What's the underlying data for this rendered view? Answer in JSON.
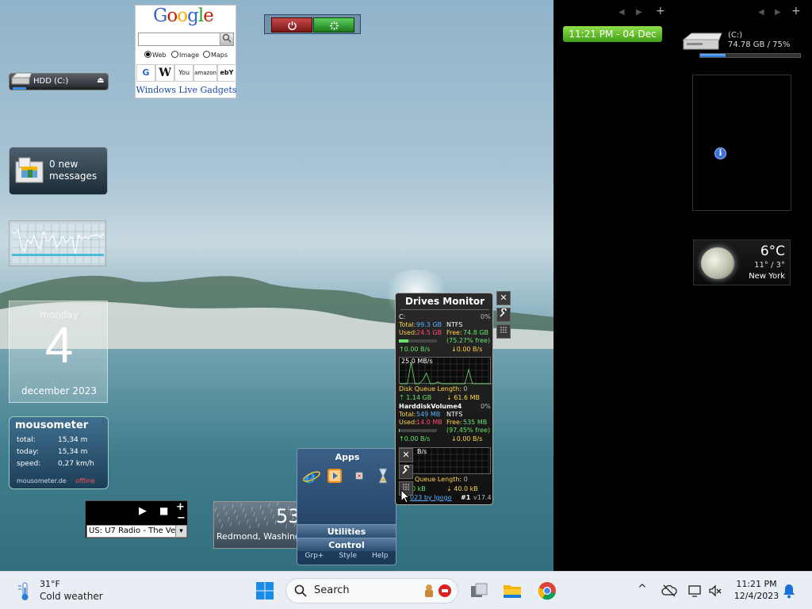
{
  "sidebar": {
    "nav_prev": "◀",
    "nav_next": "▶",
    "nav_add": "+",
    "clock": "11:21 PM - 04 Dec",
    "drive_name": "(C:)",
    "drive_usage": "74.78 GB / 75%",
    "drive_fill_percent": 25,
    "info_glyph": "i",
    "weather_temp": "6°C",
    "weather_range": "11° / 3°",
    "weather_city": "New York"
  },
  "google": {
    "logo_letters": [
      {
        "ch": "G",
        "color": "#3366cc"
      },
      {
        "ch": "o",
        "color": "#cc2200"
      },
      {
        "ch": "o",
        "color": "#ffaa00"
      },
      {
        "ch": "g",
        "color": "#3366cc"
      },
      {
        "ch": "l",
        "color": "#22aa22"
      },
      {
        "ch": "e",
        "color": "#cc2200"
      }
    ],
    "go_icon": "search-icon",
    "radio_web": "Web",
    "radio_image": "Image",
    "radio_maps": "Maps",
    "sites": [
      "G",
      "W",
      "You",
      "amazon",
      "ebY"
    ],
    "footer": "Windows Live Gadgets"
  },
  "shutdown": {
    "power_icon": "power-icon",
    "restart_icon": "restart-icon"
  },
  "hdd": {
    "label": "HDD (C:)",
    "eject": "⏏",
    "fill_percent": 15
  },
  "mail": {
    "line1": "0 new",
    "line2": "messages"
  },
  "cpu": {
    "values": [
      40,
      38,
      42,
      20,
      15,
      30,
      25,
      35,
      22,
      18,
      40,
      28,
      30,
      36,
      20,
      25,
      34,
      26,
      30,
      33,
      12,
      36,
      30,
      34,
      31,
      35,
      35,
      36,
      33,
      38
    ]
  },
  "calendar": {
    "day_name": "monday",
    "date": "4",
    "month_year": "december 2023"
  },
  "mousometer": {
    "title": "mousometer",
    "rows": [
      {
        "label": "total:",
        "value": "15,34 m"
      },
      {
        "label": "today:",
        "value": "15,34 m"
      },
      {
        "label": "speed:",
        "value": "0,27 km/h"
      }
    ],
    "site": "mousometer.de",
    "status": "offline"
  },
  "radio": {
    "play": "▶",
    "stop": "■",
    "plus": "+",
    "minus": "−",
    "station": "US: U7 Radio - The Ve",
    "arrow": "▾"
  },
  "weather_left": {
    "temp": "53",
    "city": "Redmond, Washing"
  },
  "apps": {
    "title": "Apps",
    "categories": [
      "Utilities",
      "Control"
    ],
    "footer": [
      "Grp+",
      "Style",
      "Help"
    ]
  },
  "drives_monitor": {
    "title": "Drives Monitor",
    "drive1": {
      "name": "C:",
      "percent": "0%",
      "total_label": "Total:",
      "total": "99.3 GB",
      "fs": "NTFS",
      "used_label": "Used:",
      "used": "24.5 GB",
      "free_label": "Free:",
      "free": "74.8 GB",
      "free_pct": "(75.27% free)",
      "read": "0.00 B/s",
      "write": "0.00 B/s",
      "graph_label": "25.0 MB/s",
      "queue_label": "Disk Queue Length:",
      "queue": "0",
      "bytes_read": "1.14 GB",
      "bytes_written": "61.6 MB",
      "graph": [
        0,
        0,
        0,
        60,
        0,
        0,
        10,
        30,
        0,
        0,
        5,
        0,
        0,
        0,
        0,
        0,
        0,
        0,
        40,
        0,
        0,
        0,
        0,
        0,
        0
      ]
    },
    "drive2": {
      "name": "HarddiskVolume4",
      "percent": "0%",
      "total_label": "Total:",
      "total": "549 MB",
      "fs": "NTFS",
      "used_label": "Used:",
      "used": "14.0 MB",
      "free_label": "Free:",
      "free": "535 MB",
      "free_pct": "(97.45% free)",
      "read": "0.00 B/s",
      "write": "0.00 B/s",
      "graph_label": "B/s",
      "queue_label": "Queue Length:",
      "queue": "0",
      "bytes_read": "0 kB",
      "bytes_written": "40.0 kB"
    },
    "footer_link": "023 by Igogo",
    "footer_num": "#1",
    "footer_ver": "v17.4",
    "close": "✕"
  },
  "taskbar": {
    "temp": "31°F",
    "condition": "Cold weather",
    "search": "Search",
    "time": "11:21 PM",
    "date": "12/4/2023",
    "chevron": "^"
  }
}
